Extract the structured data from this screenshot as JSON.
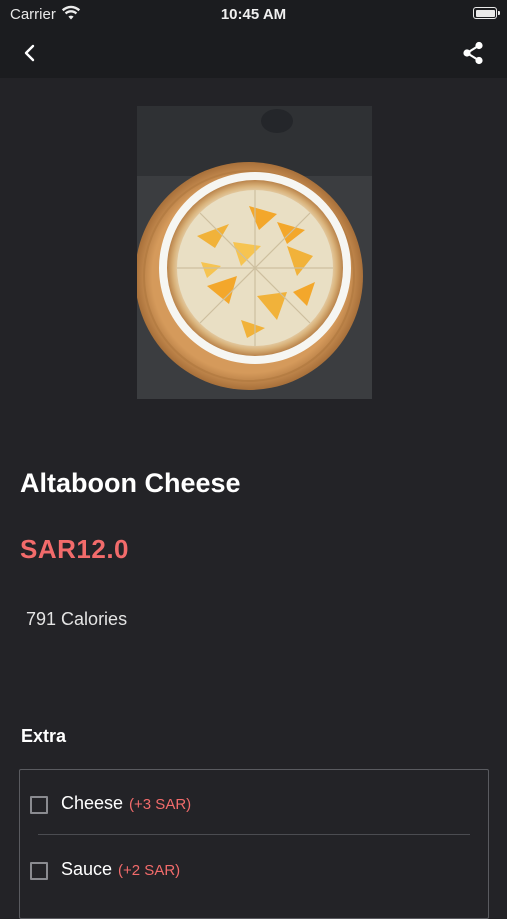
{
  "status_bar": {
    "carrier": "Carrier",
    "time": "10:45 AM"
  },
  "nav": {
    "back_icon": "chevron-left-icon",
    "share_icon": "share-icon"
  },
  "product": {
    "title": "Altaboon Cheese",
    "price": "SAR12.0",
    "calories_value": "791",
    "calories_unit": "Calories"
  },
  "extras": {
    "heading": "Extra",
    "items": [
      {
        "name": "Cheese",
        "price": "(+3 SAR)",
        "checked": false
      },
      {
        "name": "Sauce",
        "price": "(+2 SAR)",
        "checked": false
      }
    ]
  },
  "colors": {
    "background": "#232327",
    "bar": "#1b1c1f",
    "accent": "#f26b6b"
  }
}
